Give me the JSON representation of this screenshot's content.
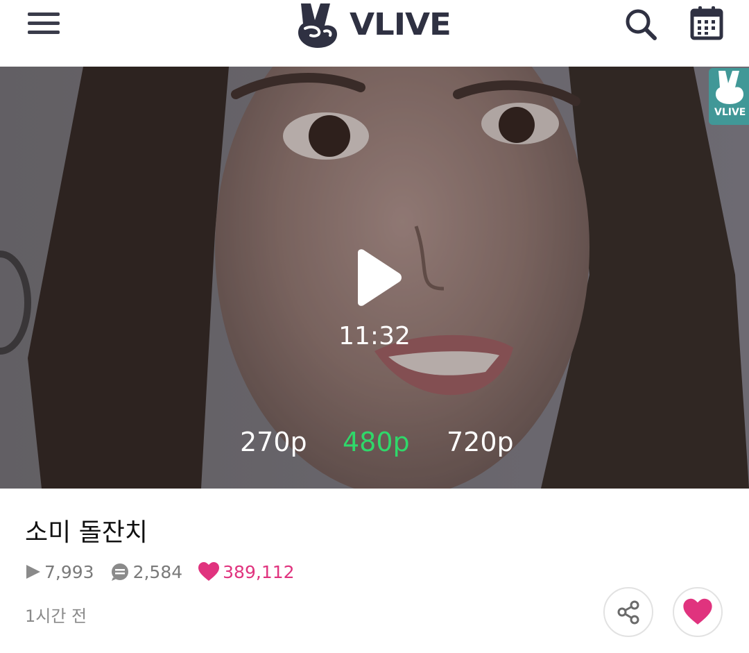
{
  "header": {
    "logo_text": "VLIVE",
    "menu_icon": "hamburger-menu-icon",
    "search_icon": "search-icon",
    "calendar_icon": "calendar-icon"
  },
  "video": {
    "duration": "11:32",
    "play_icon": "play-icon",
    "watermark_text": "VLIVE",
    "qualities": [
      "270p",
      "480p",
      "720p"
    ],
    "selected_quality": "480p",
    "selected_color": "#2fd86a"
  },
  "info": {
    "title": "소미 돌잔치",
    "views": "7,993",
    "comments": "2,584",
    "likes": "389,112",
    "time_ago": "1시간 전",
    "like_color": "#e0337e"
  },
  "actions": {
    "share_icon": "share-icon",
    "like_icon": "heart-icon"
  }
}
